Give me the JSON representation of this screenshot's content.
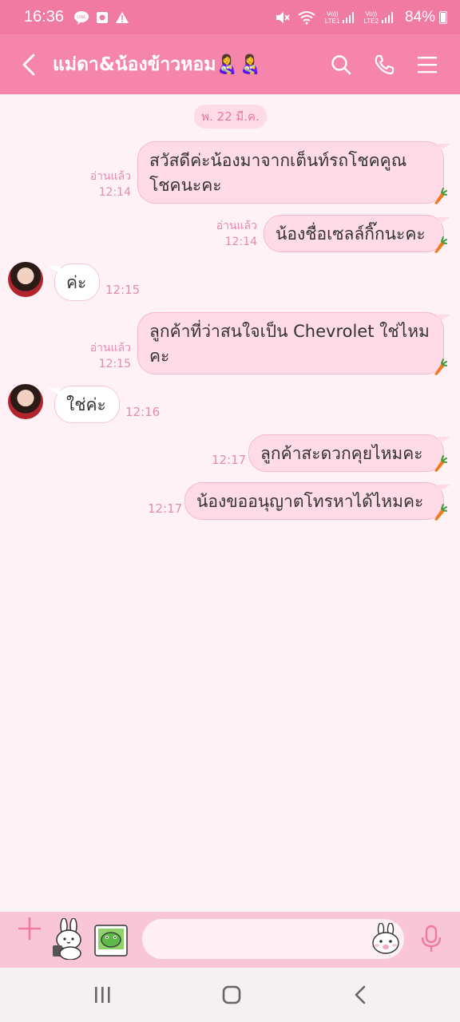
{
  "status_bar": {
    "time": "16:36",
    "left_icons": [
      "line-app-icon",
      "notification-square-icon",
      "warning-icon"
    ],
    "lte1_top": "Vo))",
    "lte1_bottom": "LTE1",
    "lte2_top": "Vo))",
    "lte2_bottom": "LTE2",
    "battery": "84%"
  },
  "header": {
    "title": "แม่ดา&น้องข้าวหอม👩‍🍼👩‍🍼",
    "accent": "#f585ab"
  },
  "date": "พ. 22 มี.ค.",
  "messages": [
    {
      "from": "me",
      "text": "สวัสดีค่ะน้องมาจากเต็นท์รถโชคคูณโชคนะคะ",
      "read": "อ่านแล้ว",
      "time": "12:14"
    },
    {
      "from": "me",
      "text": "น้องชื่อเซลล์กิ๊กนะคะ",
      "read": "อ่านแล้ว",
      "time": "12:14"
    },
    {
      "from": "them",
      "text": "ค่ะ",
      "time": "12:15"
    },
    {
      "from": "me",
      "text": "ลูกค้าที่ว่าสนใจเป็น Chevrolet ใช่ไหมคะ",
      "read": "อ่านแล้ว",
      "time": "12:15"
    },
    {
      "from": "them",
      "text": "ใช่ค่ะ",
      "time": "12:16"
    },
    {
      "from": "me",
      "text": "ลูกค้าสะดวกคุยไหมคะ",
      "read": "",
      "time": "12:17"
    },
    {
      "from": "me",
      "text": "น้องขออนุญาตโทรหาได้ไหมคะ",
      "read": "",
      "time": "12:17"
    }
  ],
  "input": {
    "value": "",
    "placeholder": ""
  },
  "colors": {
    "status_bar": "#f07aa2",
    "bubble_me": "#ffdbe8",
    "bubble_them": "#ffffff",
    "meta_text": "#e58bb0",
    "background": "#fff2f6"
  }
}
